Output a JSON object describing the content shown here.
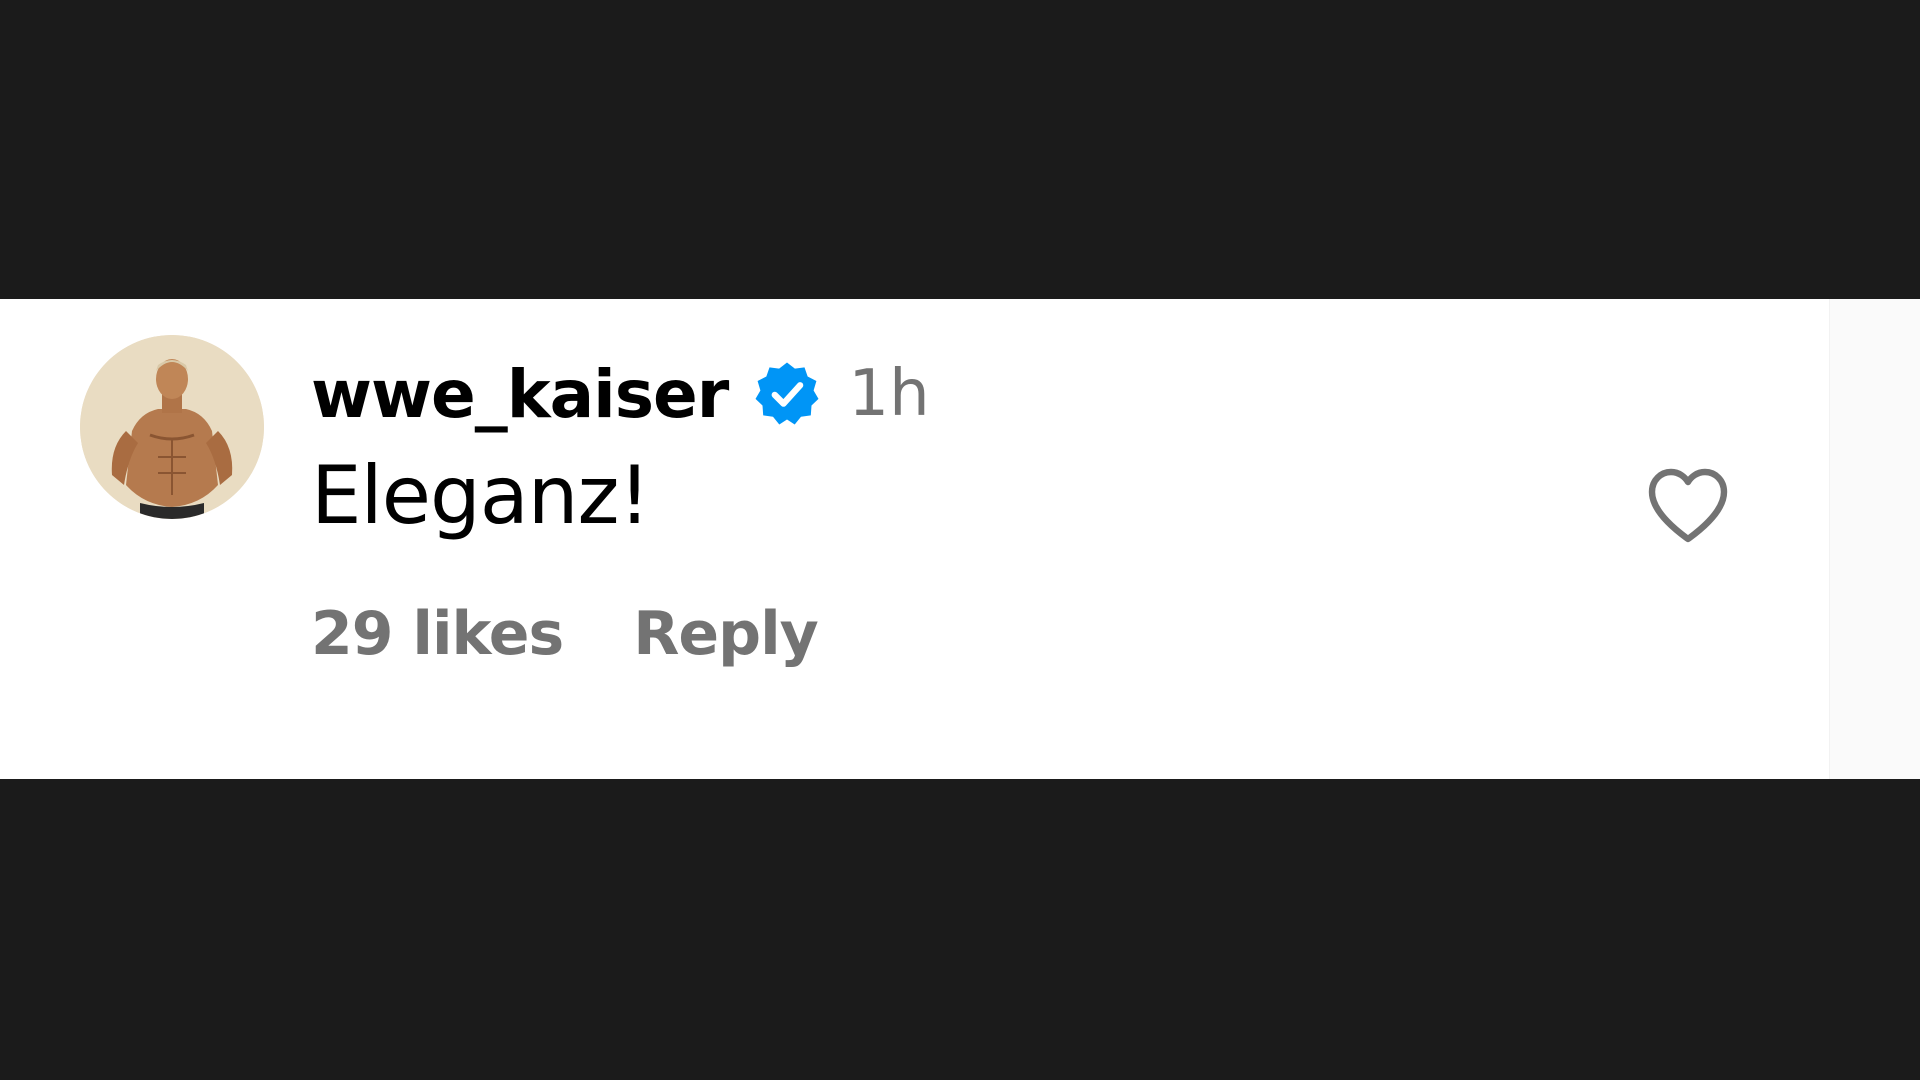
{
  "comment": {
    "username": "wwe_kaiser",
    "verified": true,
    "timestamp": "1h",
    "text": "Eleganz!",
    "likes": "29 likes",
    "reply_label": "Reply"
  },
  "icons": {
    "verified": "verified-badge-icon",
    "like": "heart-outline-icon"
  },
  "colors": {
    "letterbox": "#1b1b1b",
    "card_background": "#ffffff",
    "primary_text": "#000000",
    "secondary_text": "#737373",
    "verified_blue": "#0095f6",
    "heart_stroke": "#737373"
  }
}
